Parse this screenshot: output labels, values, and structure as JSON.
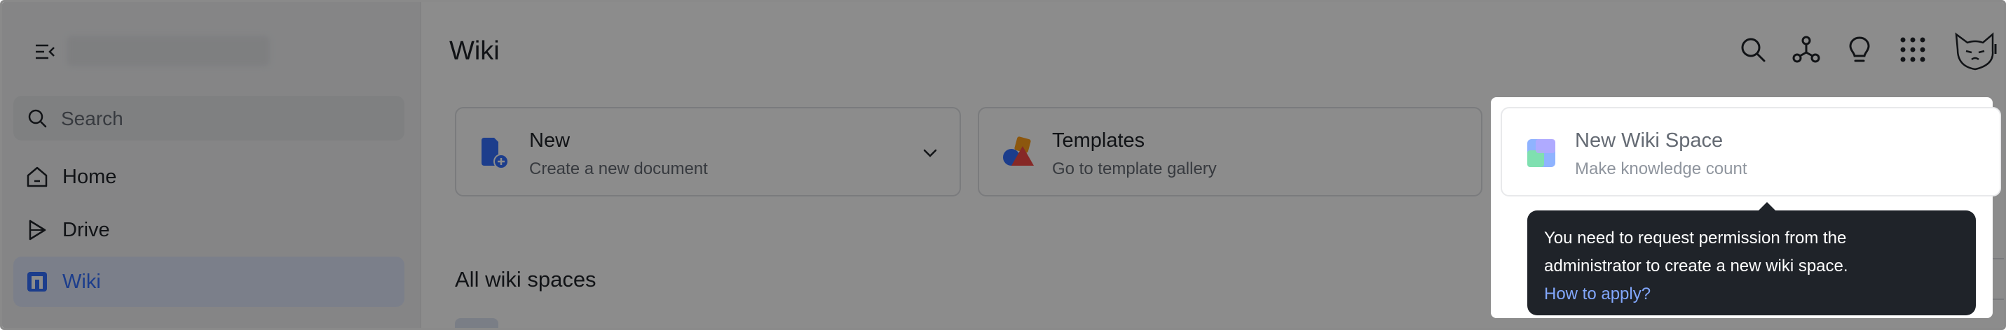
{
  "sidebar": {
    "search_placeholder": "Search",
    "items": [
      {
        "label": "Home",
        "icon": "home-icon"
      },
      {
        "label": "Drive",
        "icon": "drive-icon"
      },
      {
        "label": "Wiki",
        "icon": "wiki-icon",
        "active": true
      }
    ]
  },
  "header": {
    "title": "Wiki",
    "icons": [
      "search-icon",
      "connections-icon",
      "lightbulb-icon",
      "apps-grid-icon",
      "avatar"
    ]
  },
  "cards": {
    "new": {
      "title": "New",
      "subtitle": "Create a new document"
    },
    "templates": {
      "title": "Templates",
      "subtitle": "Go to template gallery"
    },
    "wiki_space": {
      "title": "New Wiki Space",
      "subtitle": "Make knowledge count"
    }
  },
  "section": {
    "title": "All wiki spaces"
  },
  "tooltip": {
    "line1": "You need to request permission from the",
    "line2": "administrator to create a new wiki space.",
    "link": "How to apply?"
  },
  "colors": {
    "accent": "#3370ff",
    "tooltip_bg": "#1f2329",
    "link": "#82a7fc",
    "sidebar_bg": "#f2f3f5"
  }
}
